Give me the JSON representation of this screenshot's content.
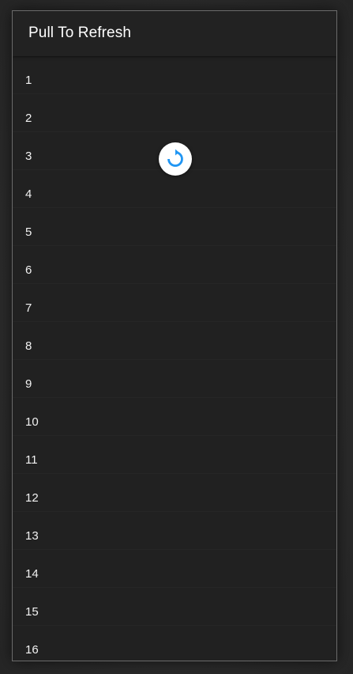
{
  "appbar": {
    "title": "Pull To Refresh"
  },
  "list": {
    "items": [
      "1",
      "2",
      "3",
      "4",
      "5",
      "6",
      "7",
      "8",
      "9",
      "10",
      "11",
      "12",
      "13",
      "14",
      "15",
      "16"
    ]
  },
  "refresh_indicator": {
    "icon": "refresh-icon",
    "color": "#2196f3"
  }
}
